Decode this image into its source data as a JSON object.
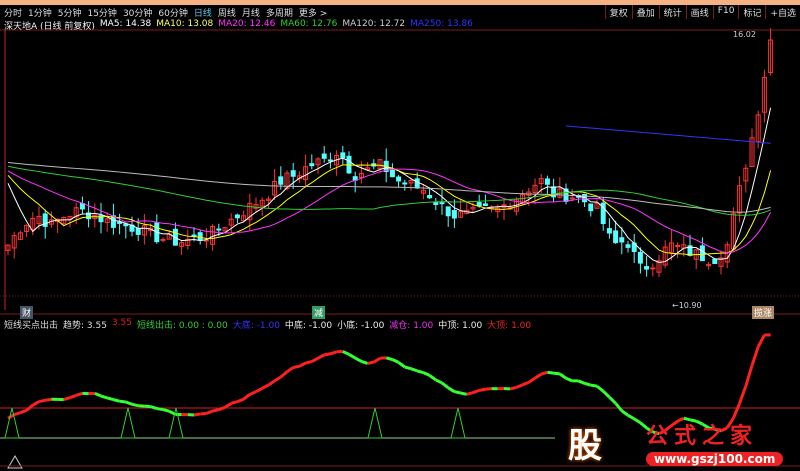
{
  "periods": [
    "分时",
    "1分钟",
    "5分钟",
    "15分钟",
    "30分钟",
    "60分钟",
    "日线",
    "周线",
    "月线",
    "多周期",
    "更多 >"
  ],
  "active_period": "日线",
  "tools": [
    "复权",
    "叠加",
    "统计",
    "画线",
    "F10",
    "标记",
    "+自选"
  ],
  "legend": {
    "name": "深天地A (日线 前复权)",
    "ma5": "MA5: 14.38",
    "ma10": "MA10: 13.08",
    "ma20": "MA20: 12.46",
    "ma60": "MA60: 12.76",
    "ma120": "MA120: 12.72",
    "ma250": "MA250: 13.86"
  },
  "colors": {
    "up": "#ff3232",
    "down": "#54ffff",
    "ma5": "#ffffff",
    "ma10": "#ffff00",
    "ma20": "#ff33ff",
    "ma60": "#33cc33",
    "ma120": "#bbbbbb",
    "ma250": "#3333ff"
  },
  "price_high": "16.02",
  "price_low": "10.90",
  "badges": [
    "财",
    "减",
    "揽涨"
  ],
  "indicator": {
    "name": "短线买点出击",
    "trend": "趋势: 3.55",
    "trend2": "3.55",
    "short": "短线出击: 0.00 : 0.00",
    "dadi": "大底: -1.00",
    "zhongdi": "中底: -1.00",
    "xiaodi": "小底: -1.00",
    "jiancang": "减仓: 1.00",
    "zhongding": "中顶: 1.00",
    "dading": "大顶: 1.00"
  },
  "logo": {
    "char": "股",
    "title": "公式之家",
    "url": "www.gszj100.com"
  },
  "keyframes": [
    11.94,
    12.32,
    12.51,
    12.32,
    12.51,
    12.6,
    12.51,
    12.38,
    12.32,
    12.26,
    12.13,
    12.04,
    12.0,
    12.07,
    12.13,
    12.32,
    12.51,
    12.7,
    12.89,
    13.17,
    13.27,
    13.46,
    13.55,
    13.74,
    13.27,
    13.36,
    13.46,
    13.17,
    13.08,
    12.98,
    12.7,
    12.51,
    12.51,
    12.6,
    12.6,
    12.79,
    12.98,
    13.17,
    12.89,
    12.89,
    12.79,
    12.6,
    11.94,
    12.04,
    11.47,
    11.66,
    11.94,
    11.85,
    11.75,
    11.66,
    11.94,
    13.17,
    14.31,
    15.83
  ]
}
